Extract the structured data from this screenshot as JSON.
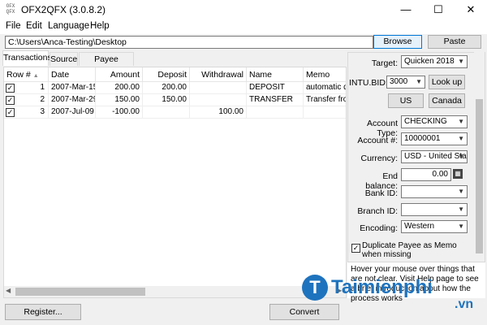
{
  "window": {
    "title": "OFX2QFX (3.0.8.2)",
    "icon_text": "OFX QFX",
    "controls": [
      "minimize-icon",
      "maximize-icon",
      "close-icon"
    ]
  },
  "menu": [
    "File",
    "Edit",
    "Language",
    "Help"
  ],
  "path": {
    "value": "C:\\Users\\Anca-Testing\\Desktop",
    "browse_label": "Browse",
    "paste_label": "Paste"
  },
  "tabs": [
    "Transactions",
    "Source",
    "Payee Mapping"
  ],
  "table": {
    "headers": [
      "Row #",
      "Date",
      "Amount",
      "Deposit",
      "Withdrawal",
      "Name",
      "Memo"
    ],
    "rows": [
      {
        "checked": true,
        "row": "1",
        "date": "2007-Mar-15",
        "amount": "200.00",
        "deposit": "200.00",
        "withdrawal": "",
        "name": "DEPOSIT",
        "memo": "automatic de"
      },
      {
        "checked": true,
        "row": "2",
        "date": "2007-Mar-29",
        "amount": "150.00",
        "deposit": "150.00",
        "withdrawal": "",
        "name": "TRANSFER",
        "memo": "Transfer fro"
      },
      {
        "checked": true,
        "row": "3",
        "date": "2007-Jul-09",
        "amount": "-100.00",
        "deposit": "",
        "withdrawal": "100.00",
        "name": "",
        "memo": ""
      }
    ]
  },
  "settings": {
    "target_label": "Target:",
    "target_value": "Quicken 2018",
    "intu_bid_label": "INTU.BID:",
    "intu_bid_value": "3000",
    "lookup_label": "Look up",
    "us_label": "US",
    "canada_label": "Canada",
    "account_type_label": "Account Type:",
    "account_type_value": "CHECKING",
    "account_num_label": "Account #:",
    "account_num_value": "10000001",
    "currency_label": "Currency:",
    "currency_value": "USD - United Sta",
    "end_balance_label": "End balance:",
    "end_balance_value": "0.00",
    "bank_id_label": "Bank ID:",
    "branch_id_label": "Branch ID:",
    "encoding_label": "Encoding:",
    "encoding_value": "Western",
    "duplicate_payee_label": "Duplicate Payee as Memo when missing",
    "duplicate_payee_checked": true
  },
  "help_text": "Hover your mouse over things that are not clear. Visit Help page to see a brief introduction about how the process works",
  "footer": {
    "register_label": "Register...",
    "convert_label": "Convert"
  },
  "watermark": {
    "brand": "Taimienphi",
    "suffix": ".vn"
  }
}
